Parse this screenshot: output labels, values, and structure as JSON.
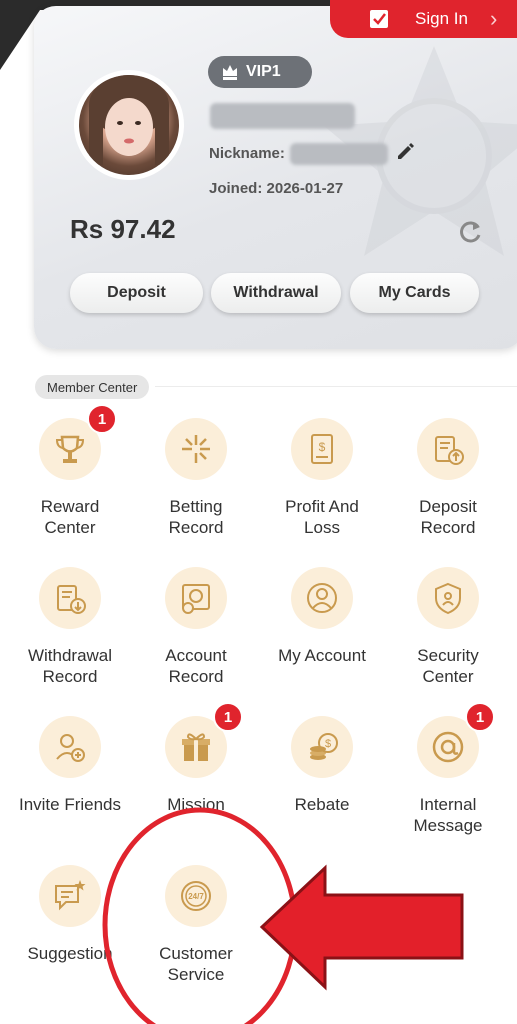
{
  "header": {
    "sign_in": "Sign In",
    "vip_level": "VIP1",
    "nickname_label": "Nickname:",
    "joined_label": "Joined:",
    "joined_date": "2026-01-27",
    "balance": "Rs 97.42"
  },
  "actions": [
    {
      "label": "Deposit"
    },
    {
      "label": "Withdrawal"
    },
    {
      "label": "My Cards"
    }
  ],
  "member_center": {
    "title": "Member Center",
    "items": [
      {
        "label": "Reward\nCenter",
        "icon": "trophy-icon",
        "badge": "1"
      },
      {
        "label": "Betting\nRecord",
        "icon": "betting-record-icon",
        "badge": ""
      },
      {
        "label": "Profit And\nLoss",
        "icon": "profit-loss-icon",
        "badge": ""
      },
      {
        "label": "Deposit\nRecord",
        "icon": "deposit-record-icon",
        "badge": ""
      },
      {
        "label": "Withdrawal\nRecord",
        "icon": "withdrawal-record-icon",
        "badge": ""
      },
      {
        "label": "Account\nRecord",
        "icon": "account-record-icon",
        "badge": ""
      },
      {
        "label": "My Account",
        "icon": "user-icon",
        "badge": ""
      },
      {
        "label": "Security\nCenter",
        "icon": "shield-icon",
        "badge": ""
      },
      {
        "label": "Invite Friends",
        "icon": "invite-friends-icon",
        "badge": ""
      },
      {
        "label": "Mission",
        "icon": "gift-icon",
        "badge": "1"
      },
      {
        "label": "Rebate",
        "icon": "coins-icon",
        "badge": ""
      },
      {
        "label": "Internal\nMessage",
        "icon": "at-sign-icon",
        "badge": "1"
      },
      {
        "label": "Suggestion",
        "icon": "chat-icon",
        "badge": ""
      },
      {
        "label": "Customer\nService",
        "icon": "support-24-7-icon",
        "badge": ""
      }
    ]
  },
  "colors": {
    "accent_red": "#e0242d",
    "icon_bg": "#fbeed9",
    "icon_gold": "#c99a4e"
  }
}
